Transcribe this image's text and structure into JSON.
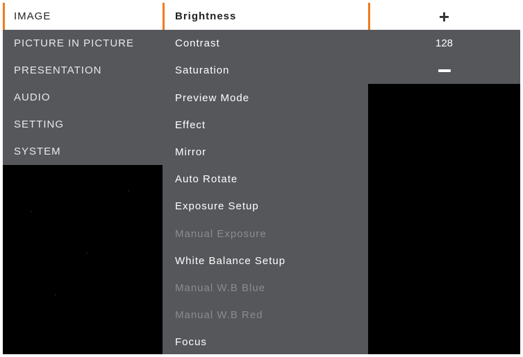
{
  "menu": {
    "categories": [
      {
        "label": "IMAGE",
        "selected": true
      },
      {
        "label": "PICTURE IN PICTURE",
        "selected": false
      },
      {
        "label": "PRESENTATION",
        "selected": false
      },
      {
        "label": "AUDIO",
        "selected": false
      },
      {
        "label": "SETTING",
        "selected": false
      },
      {
        "label": "SYSTEM",
        "selected": false
      }
    ],
    "items": [
      {
        "label": "Brightness",
        "selected": true,
        "enabled": true
      },
      {
        "label": "Contrast",
        "selected": false,
        "enabled": true
      },
      {
        "label": "Saturation",
        "selected": false,
        "enabled": true
      },
      {
        "label": "Preview Mode",
        "selected": false,
        "enabled": true
      },
      {
        "label": "Effect",
        "selected": false,
        "enabled": true
      },
      {
        "label": "Mirror",
        "selected": false,
        "enabled": true
      },
      {
        "label": "Auto Rotate",
        "selected": false,
        "enabled": true
      },
      {
        "label": "Exposure Setup",
        "selected": false,
        "enabled": true
      },
      {
        "label": "Manual Exposure",
        "selected": false,
        "enabled": false
      },
      {
        "label": "White Balance Setup",
        "selected": false,
        "enabled": true
      },
      {
        "label": "Manual W.B Blue",
        "selected": false,
        "enabled": false
      },
      {
        "label": "Manual W.B Red",
        "selected": false,
        "enabled": false
      },
      {
        "label": "Focus",
        "selected": false,
        "enabled": true
      }
    ],
    "adjust": {
      "increase_icon": "plus-icon",
      "value": "128",
      "decrease_icon": "minus-icon"
    }
  },
  "colors": {
    "panel": "#55575b",
    "selected": "#ffffff",
    "accent": "#f07a1e",
    "disabled_text": "#8a8c8f",
    "background": "#000000"
  }
}
